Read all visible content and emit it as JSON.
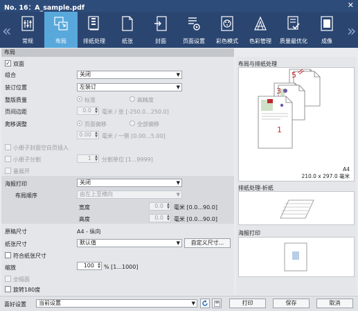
{
  "window": {
    "title": "No. 16：A_sample.pdf",
    "close_icon": "close-icon"
  },
  "tabs": [
    {
      "label": "常规",
      "icon": "general-icon",
      "active": false
    },
    {
      "label": "布局",
      "icon": "layout-icon",
      "active": true
    },
    {
      "label": "排纸处理",
      "icon": "finishing-icon",
      "active": false
    },
    {
      "label": "纸张",
      "icon": "paper-icon",
      "active": false
    },
    {
      "label": "封面",
      "icon": "cover-icon",
      "active": false
    },
    {
      "label": "页面设置",
      "icon": "page-setup-icon",
      "active": false
    },
    {
      "label": "彩色模式",
      "icon": "color-mode-icon",
      "active": false
    },
    {
      "label": "色彩管理",
      "icon": "color-management-icon",
      "active": false
    },
    {
      "label": "质量最优化",
      "icon": "quality-icon",
      "active": false
    },
    {
      "label": "成像",
      "icon": "imaging-icon",
      "active": false
    }
  ],
  "layout": {
    "section_title": "布局",
    "duplex": {
      "label": "双面",
      "checked": true
    },
    "combination": {
      "label": "组合",
      "value": "关闭"
    },
    "binding_position": {
      "label": "装订位置",
      "value": "左装订"
    },
    "imposition_quality": {
      "label": "整版质量",
      "option_standard": "标准",
      "option_high": "高精度"
    },
    "page_margin": {
      "label": "页间边距",
      "value": "0.0",
      "unit": "毫米 / 张 [-250.0...250.0]"
    },
    "creep": {
      "label": "爬移调整",
      "option_page_shift": "页面偏移",
      "option_all_shift": "全部偏移",
      "value": "0.00",
      "unit": "毫米 / 一侧 [0.00...5.00]"
    },
    "booklet_blank": {
      "label": "小册子封面空白页插入"
    },
    "booklet_split": {
      "label": "小册子分割",
      "value": "1",
      "unit": "分割单位 [1...9999]"
    },
    "gatefold": {
      "label": "垂展开"
    }
  },
  "poster": {
    "label": "海报打印",
    "value": "关闭",
    "order_label": "布局顺序",
    "order_value": "由左上至横向",
    "width_label": "宽度",
    "width_value": "0.0",
    "width_unit": "毫米 [0.0...90.0]",
    "height_label": "高度",
    "height_value": "0.0",
    "height_unit": "毫米 [0.0...90.0]"
  },
  "paper": {
    "original_size_label": "原稿尺寸",
    "original_size_value": "A4 - 纵向",
    "paper_size_label": "纸张尺寸",
    "paper_size_value": "默认值",
    "custom_size_button": "自定义尺寸...",
    "fit_paper_label": "符合纸张尺寸",
    "zoom_label": "缩放",
    "zoom_value": "100",
    "zoom_unit": "% [1...1000]",
    "full_bleed_label": "全幅面",
    "rotate_label": "旋转180度"
  },
  "preview": {
    "layout_title": "布局与排纸处理",
    "page_numbers": [
      "5",
      "3",
      "1"
    ],
    "paper_name": "A4",
    "paper_dims": "210.0 x 297.0 毫米",
    "finishing_title": "排纸处理-折纸",
    "poster_title": "海报打印"
  },
  "footer": {
    "favorites_label": "喜好设置",
    "favorites_value": "当前设置",
    "print_button": "打印",
    "save_button": "保存",
    "cancel_button": "取消"
  },
  "colors": {
    "titlebar": "#2e4c7a",
    "tabbar": "#2a4570",
    "active_tab": "#58a8dc",
    "accent_red": "#c0282d",
    "accent_violet": "#6b5ba8"
  }
}
